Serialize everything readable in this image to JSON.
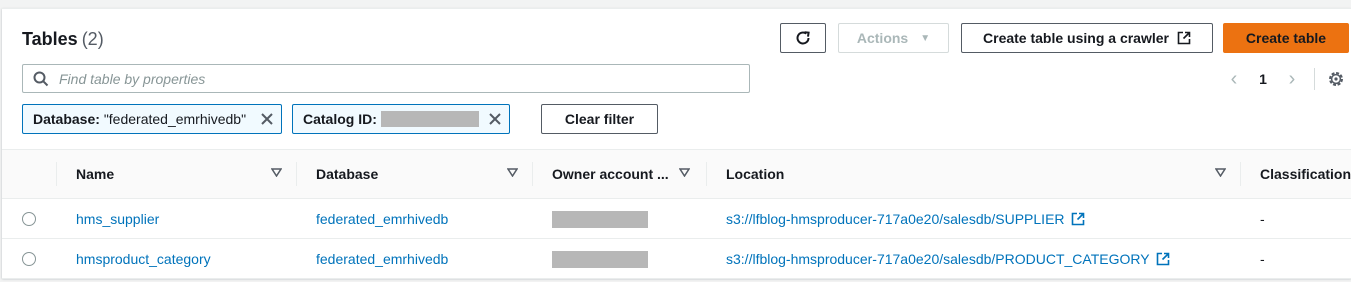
{
  "header": {
    "title": "Tables",
    "count": "(2)"
  },
  "toolbar": {
    "actions_label": "Actions",
    "crawler_label": "Create table using a crawler",
    "create_label": "Create table",
    "clear_filter_label": "Clear filter"
  },
  "search": {
    "placeholder": "Find table by properties",
    "value": ""
  },
  "pagination": {
    "current_page": "1"
  },
  "filters": [
    {
      "key": "Database:",
      "value": "\"federated_emrhivedb\""
    },
    {
      "key": "Catalog ID:",
      "value": ""
    }
  ],
  "columns": [
    "Name",
    "Database",
    "Owner account ...",
    "Location",
    "Classification"
  ],
  "rows": [
    {
      "name": "hms_supplier",
      "database": "federated_emrhivedb",
      "owner": "",
      "location": "s3://lfblog-hmsproducer-717a0e20/salesdb/SUPPLIER",
      "classification": "-"
    },
    {
      "name": "hmsproduct_category",
      "database": "federated_emrhivedb",
      "owner": "",
      "location": "s3://lfblog-hmsproducer-717a0e20/salesdb/PRODUCT_CATEGORY",
      "classification": "-"
    }
  ],
  "colors": {
    "accent": "#0073bb",
    "primary_button": "#ec7211",
    "redaction": "#b7b7b7"
  },
  "icons": [
    "refresh-icon",
    "caret-down-icon",
    "external-link-icon",
    "search-icon",
    "chevron-left-icon",
    "chevron-right-icon",
    "gear-icon",
    "close-icon",
    "sort-icon"
  ]
}
